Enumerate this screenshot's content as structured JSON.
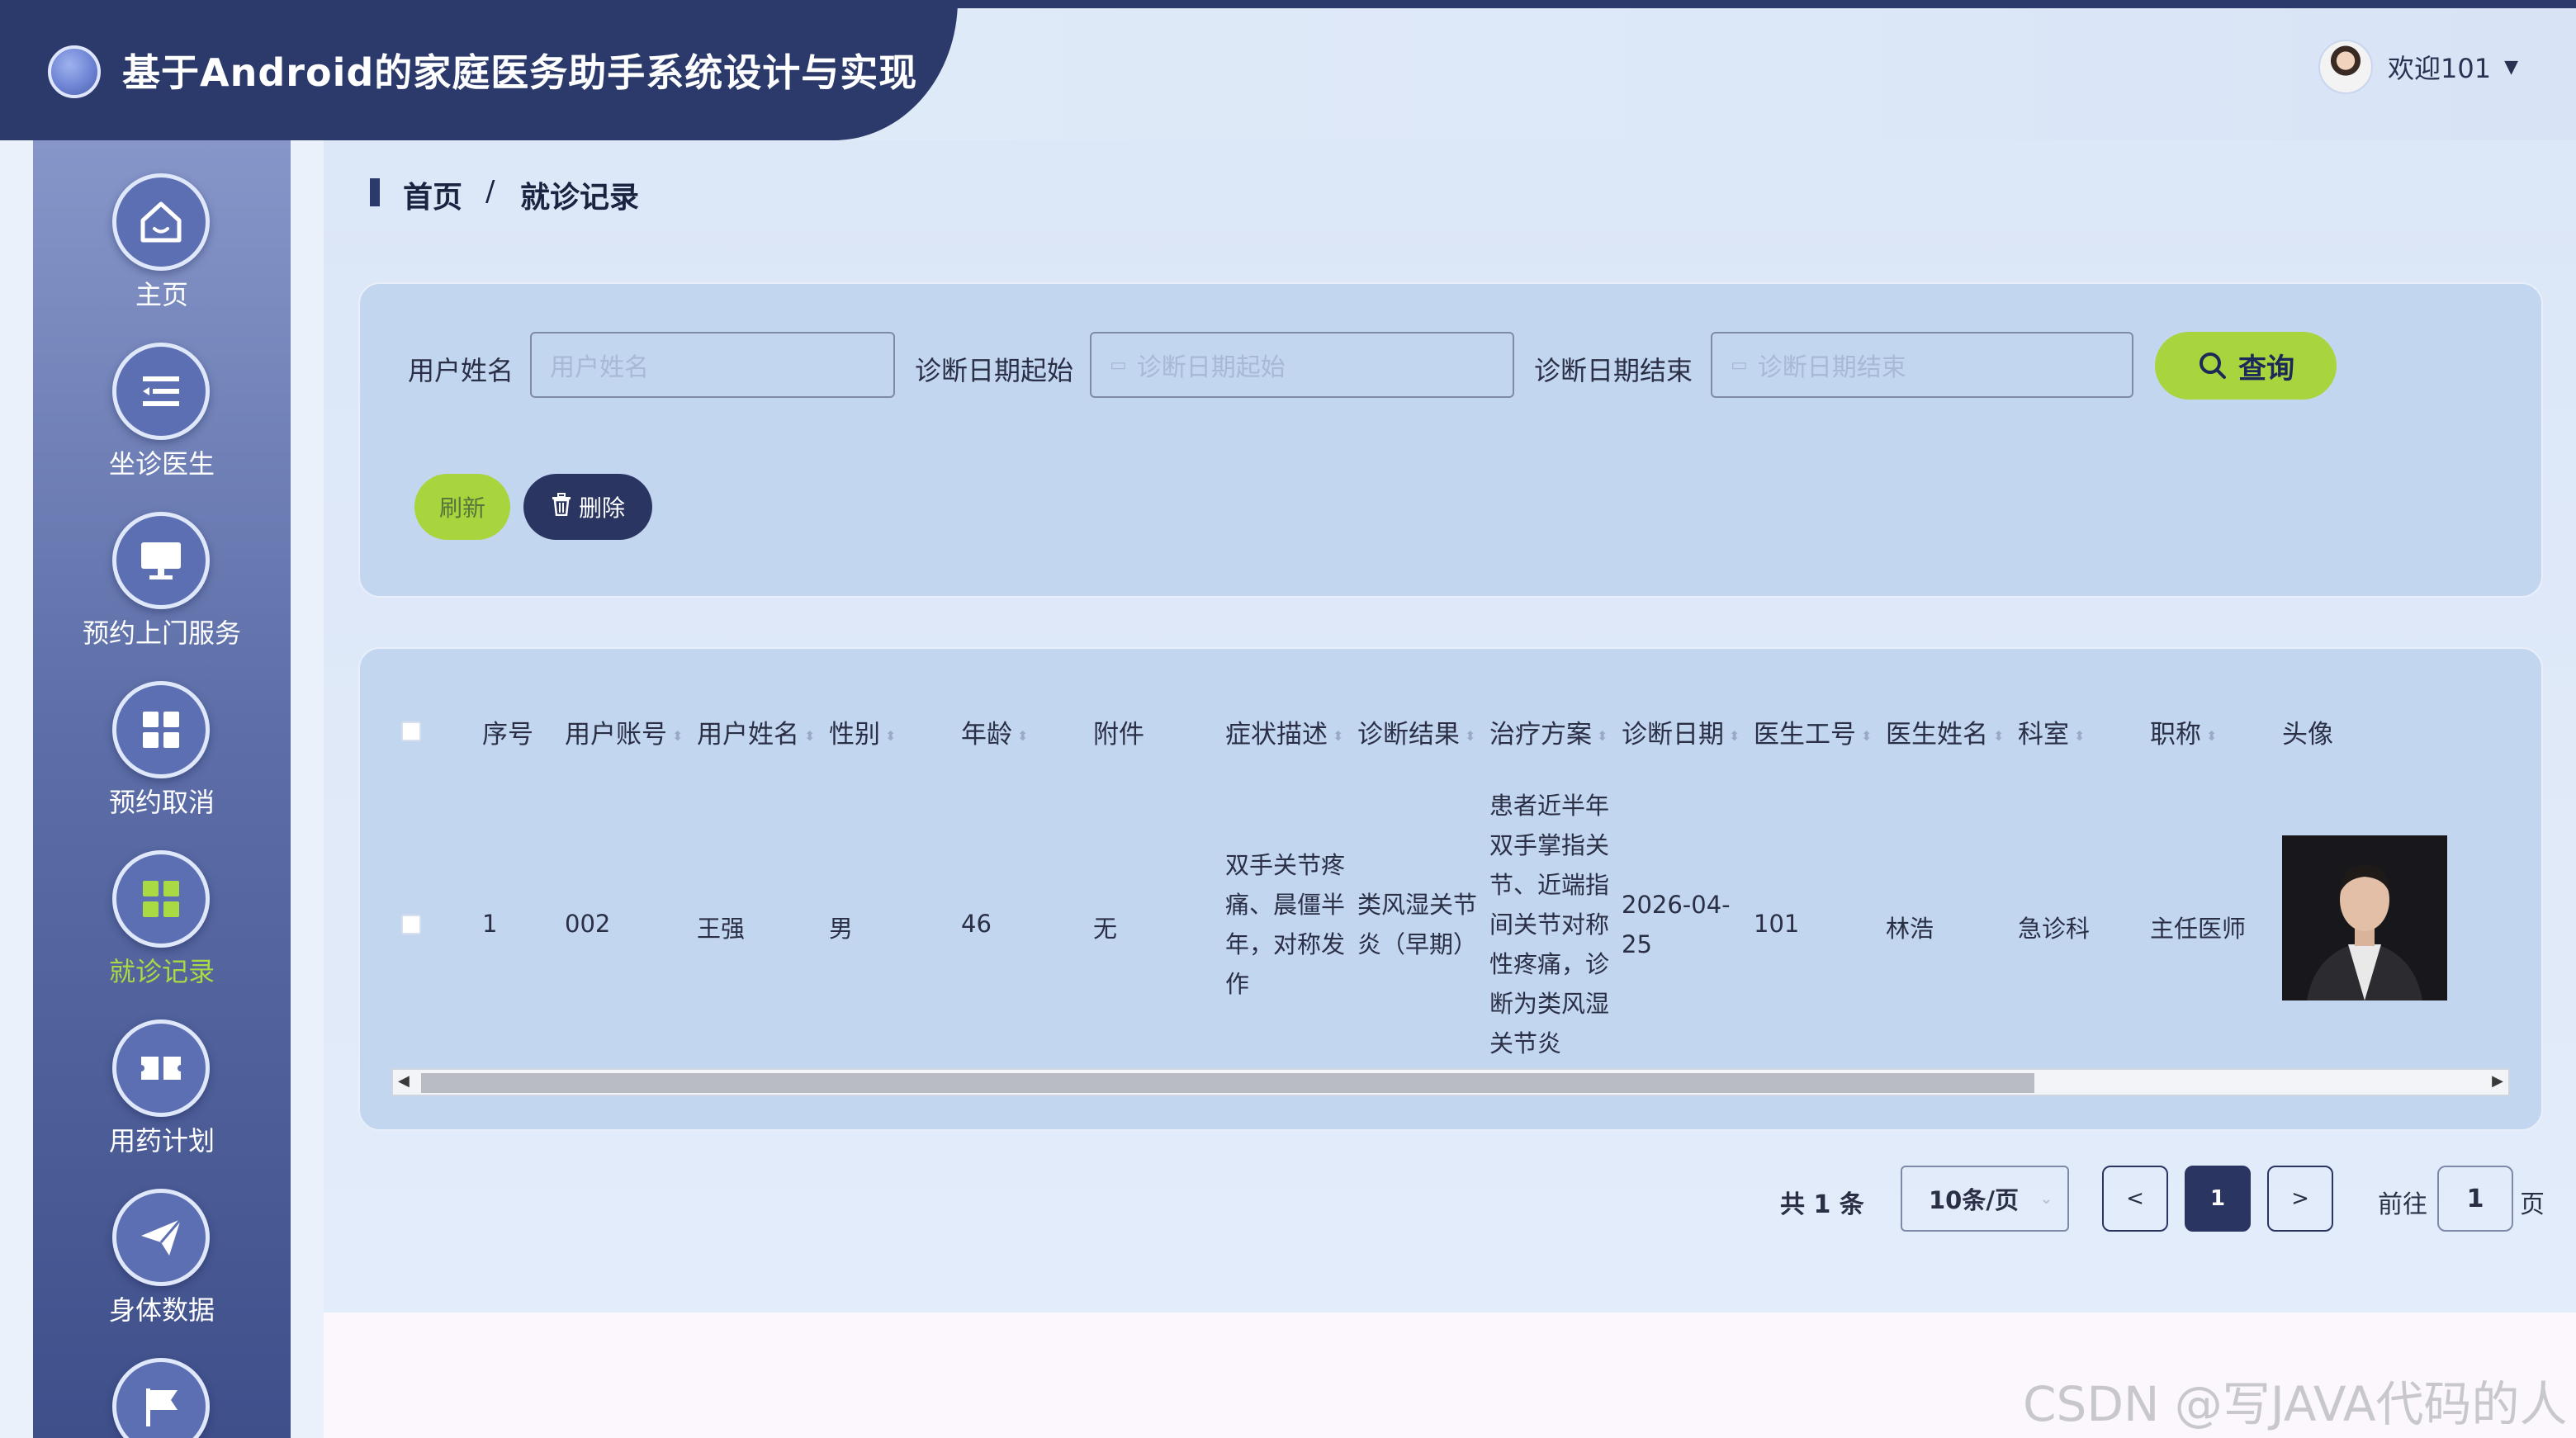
{
  "app": {
    "title": "基于Android的家庭医务助手系统设计与实现",
    "welcome": "欢迎101"
  },
  "sidebar": {
    "items": [
      {
        "label": "主页",
        "icon": "home-icon"
      },
      {
        "label": "坐诊医生",
        "icon": "list-icon"
      },
      {
        "label": "预约上门服务",
        "icon": "monitor-icon"
      },
      {
        "label": "预约取消",
        "icon": "grid-icon"
      },
      {
        "label": "就诊记录",
        "icon": "grid-icon",
        "active": true
      },
      {
        "label": "用药计划",
        "icon": "ticket-icon"
      },
      {
        "label": "身体数据",
        "icon": "send-icon"
      },
      {
        "label": "",
        "icon": "flag-icon"
      }
    ]
  },
  "breadcrumb": {
    "home": "首页",
    "separator": "/",
    "current": "就诊记录"
  },
  "search": {
    "username_label": "用户姓名",
    "username_placeholder": "用户姓名",
    "date_start_label": "诊断日期起始",
    "date_start_placeholder": "诊断日期起始",
    "date_end_label": "诊断日期结束",
    "date_end_placeholder": "诊断日期结束",
    "query_label": "查询",
    "refresh_label": "刷新",
    "delete_label": "删除"
  },
  "table": {
    "columns": [
      "序号",
      "用户账号",
      "用户姓名",
      "性别",
      "年龄",
      "附件",
      "症状描述",
      "诊断结果",
      "治疗方案",
      "诊断日期",
      "医生工号",
      "医生姓名",
      "科室",
      "职称",
      "头像"
    ],
    "rows": [
      {
        "index": "1",
        "account": "002",
        "name": "王强",
        "gender": "男",
        "age": "46",
        "attachment": "无",
        "symptom": "双手关节疼痛、晨僵半年，对称发作",
        "diagnosis": "类风湿关节炎（早期）",
        "treatment": "患者近半年双手掌指关节、近端指间关节对称性疼痛，诊断为类风湿关节炎",
        "date": "2026-04-25",
        "doctor_id": "101",
        "doctor_name": "林浩",
        "department": "急诊科",
        "title": "主任医师"
      }
    ]
  },
  "pagination": {
    "total": "共 1 条",
    "page_size": "10条/页",
    "prev": "<",
    "current": "1",
    "next": ">",
    "goto_label": "前往",
    "goto_value": "1",
    "page_suffix": "页"
  },
  "watermark": "CSDN @写JAVA代码的人",
  "colors": {
    "navy": "#2b3a6b",
    "accent_green": "#a8d43d",
    "card": "#c3d6ef"
  }
}
